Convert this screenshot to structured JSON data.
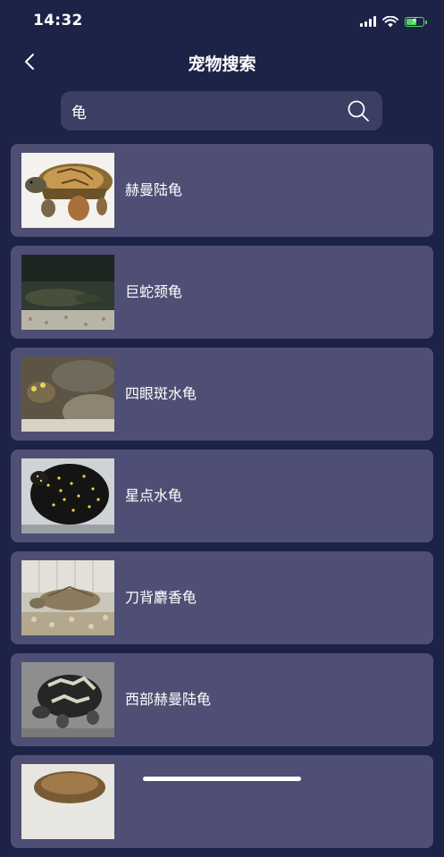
{
  "status_bar": {
    "time": "14:32"
  },
  "nav": {
    "title": "宠物搜索"
  },
  "search": {
    "value": "龟",
    "placeholder": ""
  },
  "results": [
    {
      "name": "赫曼陆龟"
    },
    {
      "name": "巨蛇颈龟"
    },
    {
      "name": "四眼斑水龟"
    },
    {
      "name": "星点水龟"
    },
    {
      "name": "刀背麝香龟"
    },
    {
      "name": "西部赫曼陆龟"
    },
    {
      "name": ""
    }
  ],
  "icons": {
    "back": "chevron-left-icon",
    "search": "search-icon",
    "signal": "cellular-signal-icon",
    "wifi": "wifi-icon",
    "battery": "battery-charging-icon"
  },
  "colors": {
    "background": "#1d2347",
    "card": "#4f4e74",
    "search_box": "#3a3f63",
    "battery": "#4cd964"
  }
}
